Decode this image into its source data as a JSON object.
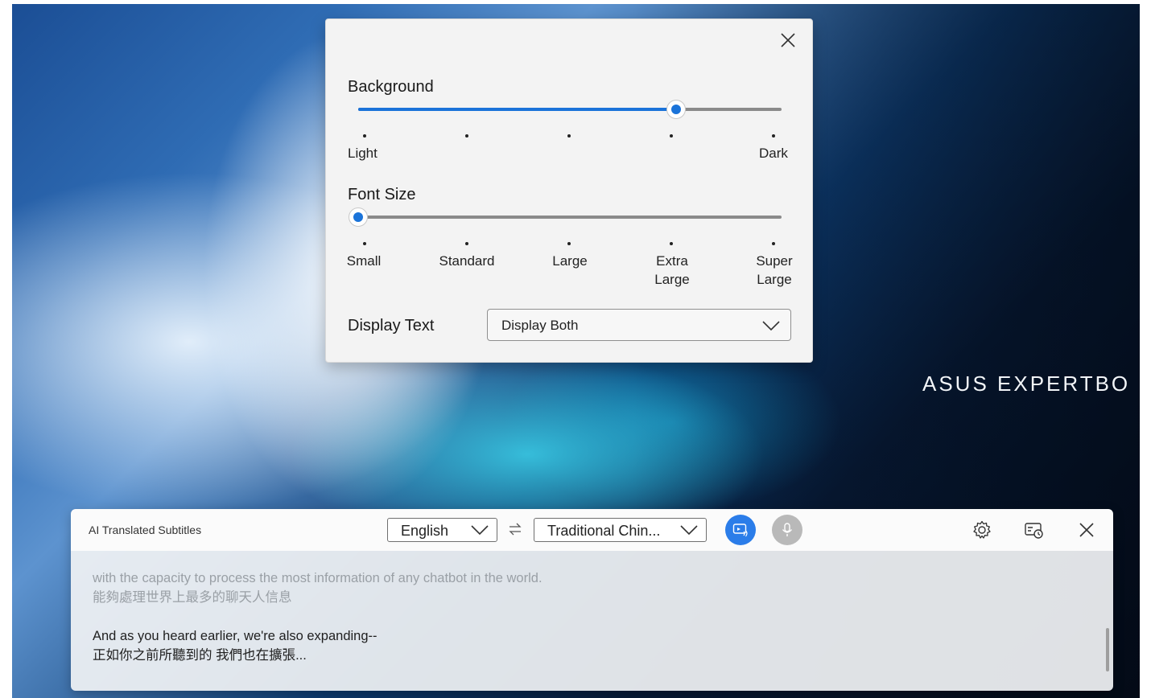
{
  "brand": {
    "text": "ASUS EXPERTBO"
  },
  "settings_popup": {
    "background": {
      "title": "Background",
      "min_label": "Light",
      "max_label": "Dark",
      "steps": 5,
      "selected_step": 4
    },
    "font_size": {
      "title": "Font Size",
      "options": [
        "Small",
        "Standard",
        "Large",
        "Extra\nLarge",
        "Super\nLarge"
      ],
      "selected_step": 1
    },
    "display_text": {
      "label": "Display Text",
      "value": "Display Both"
    }
  },
  "subtitle_bar": {
    "title": "AI Translated Subtitles",
    "source_language": "English",
    "target_language": "Traditional Chin...",
    "captions": [
      {
        "original": "with the capacity to process the most information of any chatbot in the world.",
        "translation": "能夠處理世界上最多的聊天人信息",
        "state": "faded"
      },
      {
        "original": "And as you heard earlier, we're also expanding--",
        "translation": "正如你之前所聽到的 我們也在擴張...",
        "state": "current"
      }
    ]
  },
  "colors": {
    "accent": "#1a73d9",
    "video_button": "#2b7de9",
    "mic_button_disabled": "#b9b9b9"
  }
}
